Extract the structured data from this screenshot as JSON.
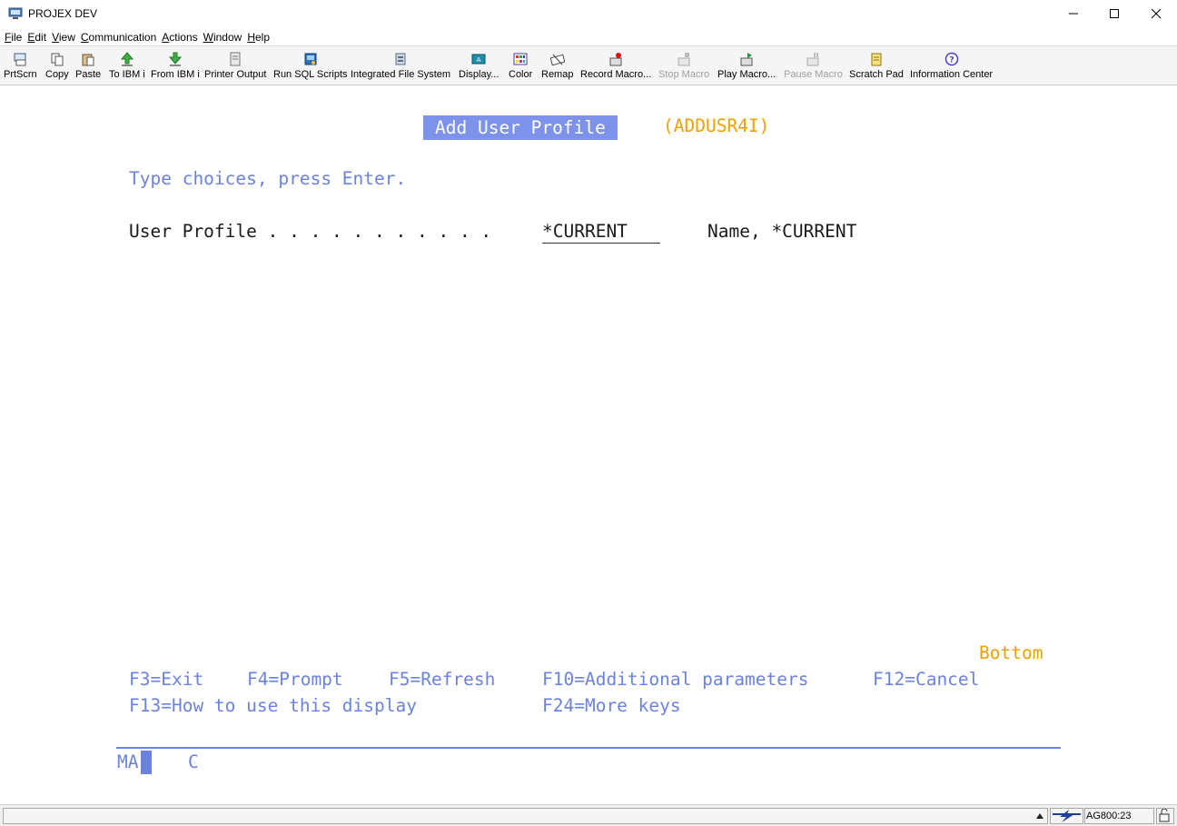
{
  "window": {
    "title": "PROJEX DEV"
  },
  "menu": [
    {
      "key": "F",
      "rest": "ile"
    },
    {
      "key": "E",
      "rest": "dit"
    },
    {
      "key": "V",
      "rest": "iew"
    },
    {
      "key": "C",
      "rest": "ommunication"
    },
    {
      "key": "A",
      "rest": "ctions"
    },
    {
      "key": "W",
      "rest": "indow"
    },
    {
      "key": "H",
      "rest": "elp"
    }
  ],
  "toolbar": {
    "prtscrn": "PrtScrn",
    "copy": "Copy",
    "paste": "Paste",
    "to_ibm": "To IBM i",
    "from_ibm": "From IBM i",
    "printer_output": "Printer Output",
    "run_sql": "Run SQL Scripts",
    "ifs": "Integrated File System",
    "display": "Display...",
    "color": "Color",
    "remap": "Remap",
    "record_macro": "Record Macro...",
    "stop_macro": "Stop Macro",
    "play_macro": "Play Macro...",
    "pause_macro": "Pause Macro",
    "scratch_pad": "Scratch Pad",
    "info_center": "Information Center"
  },
  "screen": {
    "title": "Add User Profile",
    "command": "(ADDUSR4I)",
    "instructions": "Type choices, press Enter.",
    "field_label": "User Profile . . . . . . . . . . .",
    "field_value": "*CURRENT",
    "field_hint": "Name, *CURRENT",
    "bottom": "Bottom",
    "fkeys_line1": [
      "F3=Exit",
      "F4=Prompt",
      "F5=Refresh",
      "F10=Additional parameters",
      "F12=Cancel"
    ],
    "fkeys_line2": [
      "F13=How to use this display",
      "F24=More keys"
    ],
    "oia_left": "MA",
    "oia_mid": "C"
  },
  "status": {
    "position": "AG800:23"
  }
}
